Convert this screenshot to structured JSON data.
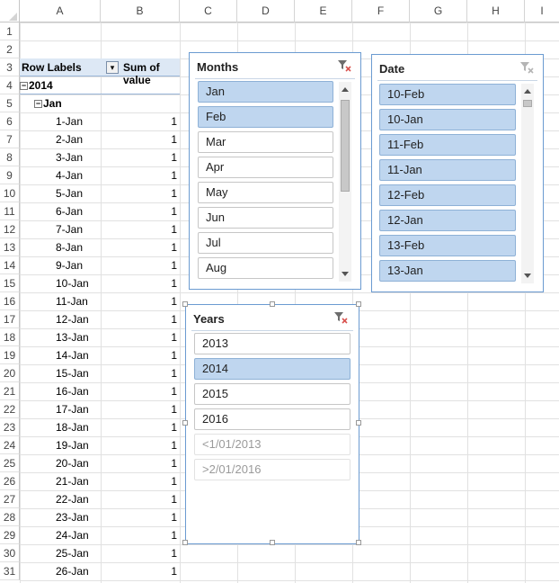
{
  "columns": [
    "A",
    "B",
    "C",
    "D",
    "E",
    "F",
    "G",
    "H",
    "I"
  ],
  "rows": [
    "1",
    "2",
    "3",
    "4",
    "5",
    "6",
    "7",
    "8",
    "9",
    "10",
    "11",
    "12",
    "13",
    "14",
    "15",
    "16",
    "17",
    "18",
    "19",
    "20",
    "21",
    "22",
    "23",
    "24",
    "25",
    "26",
    "27",
    "28",
    "29",
    "30",
    "31"
  ],
  "pivot": {
    "row_labels_header": "Row Labels",
    "value_header": "Sum of value",
    "filter_icon": "filter-dropdown-icon",
    "year": "2014",
    "month": "Jan",
    "entries": [
      {
        "label": "1-Jan",
        "value": "1"
      },
      {
        "label": "2-Jan",
        "value": "1"
      },
      {
        "label": "3-Jan",
        "value": "1"
      },
      {
        "label": "4-Jan",
        "value": "1"
      },
      {
        "label": "5-Jan",
        "value": "1"
      },
      {
        "label": "6-Jan",
        "value": "1"
      },
      {
        "label": "7-Jan",
        "value": "1"
      },
      {
        "label": "8-Jan",
        "value": "1"
      },
      {
        "label": "9-Jan",
        "value": "1"
      },
      {
        "label": "10-Jan",
        "value": "1"
      },
      {
        "label": "11-Jan",
        "value": "1"
      },
      {
        "label": "12-Jan",
        "value": "1"
      },
      {
        "label": "13-Jan",
        "value": "1"
      },
      {
        "label": "14-Jan",
        "value": "1"
      },
      {
        "label": "15-Jan",
        "value": "1"
      },
      {
        "label": "16-Jan",
        "value": "1"
      },
      {
        "label": "17-Jan",
        "value": "1"
      },
      {
        "label": "18-Jan",
        "value": "1"
      },
      {
        "label": "19-Jan",
        "value": "1"
      },
      {
        "label": "20-Jan",
        "value": "1"
      },
      {
        "label": "21-Jan",
        "value": "1"
      },
      {
        "label": "22-Jan",
        "value": "1"
      },
      {
        "label": "23-Jan",
        "value": "1"
      },
      {
        "label": "24-Jan",
        "value": "1"
      },
      {
        "label": "25-Jan",
        "value": "1"
      },
      {
        "label": "26-Jan",
        "value": "1"
      }
    ]
  },
  "slicers": {
    "months": {
      "title": "Months",
      "items": [
        {
          "label": "Jan",
          "selected": true
        },
        {
          "label": "Feb",
          "selected": true
        },
        {
          "label": "Mar",
          "selected": false
        },
        {
          "label": "Apr",
          "selected": false
        },
        {
          "label": "May",
          "selected": false
        },
        {
          "label": "Jun",
          "selected": false
        },
        {
          "label": "Jul",
          "selected": false
        },
        {
          "label": "Aug",
          "selected": false
        }
      ]
    },
    "date": {
      "title": "Date",
      "items": [
        {
          "label": "10-Feb",
          "selected": true
        },
        {
          "label": "10-Jan",
          "selected": true
        },
        {
          "label": "11-Feb",
          "selected": true
        },
        {
          "label": "11-Jan",
          "selected": true
        },
        {
          "label": "12-Feb",
          "selected": true
        },
        {
          "label": "12-Jan",
          "selected": true
        },
        {
          "label": "13-Feb",
          "selected": true
        },
        {
          "label": "13-Jan",
          "selected": true
        }
      ]
    },
    "years": {
      "title": "Years",
      "items": [
        {
          "label": "2013",
          "selected": false,
          "nodata": false
        },
        {
          "label": "2014",
          "selected": true,
          "nodata": false
        },
        {
          "label": "2015",
          "selected": false,
          "nodata": false
        },
        {
          "label": "2016",
          "selected": false,
          "nodata": false
        },
        {
          "label": "<1/01/2013",
          "selected": false,
          "nodata": true
        },
        {
          "label": ">2/01/2016",
          "selected": false,
          "nodata": true
        }
      ]
    }
  },
  "colors": {
    "selected_item": "#bfd6ef",
    "slicer_border": "#6b9bd1",
    "pivot_header": "#dde8f5",
    "clear_filter_x": "#d9534f"
  }
}
